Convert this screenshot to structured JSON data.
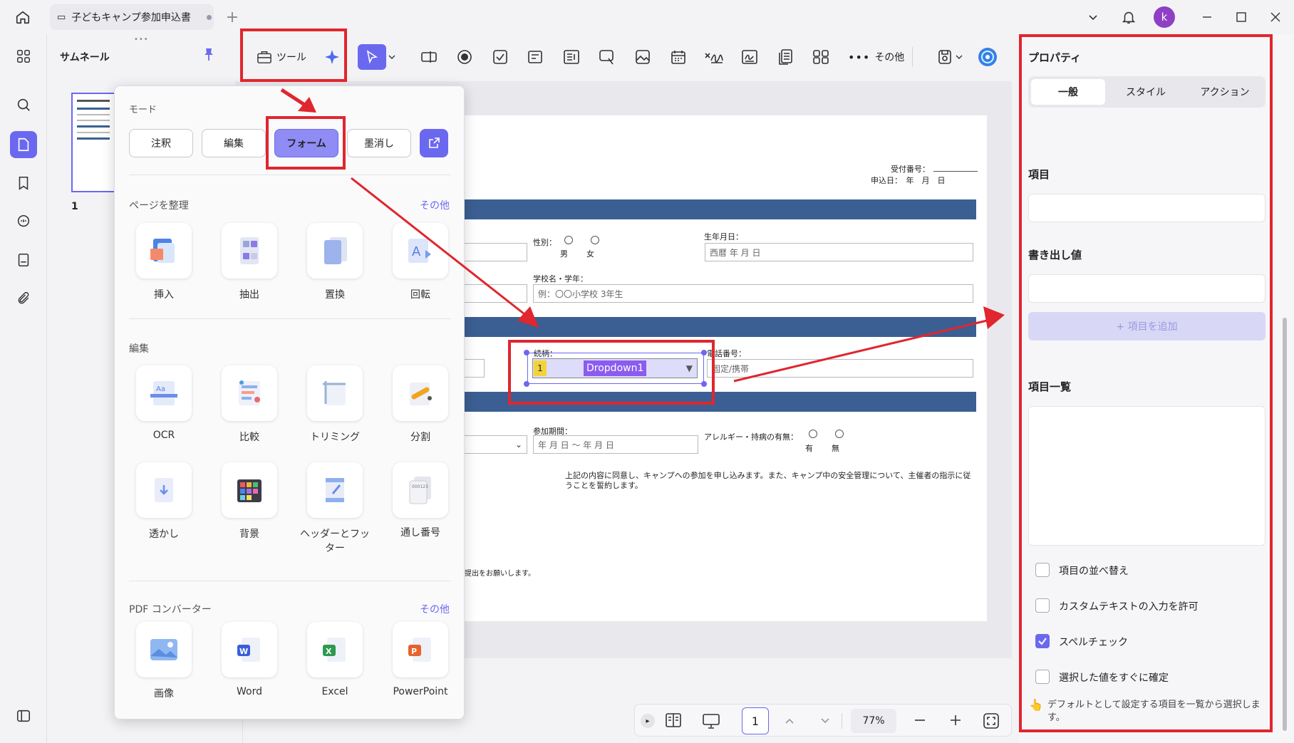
{
  "titlebar": {
    "tab_title": "子どもキャンプ参加申込書",
    "avatar_letter": "k"
  },
  "thumbnail": {
    "title": "サムネール",
    "page_number": "1"
  },
  "toolbar": {
    "tools_label": "ツール",
    "more_label": "その他"
  },
  "popup": {
    "mode_title": "モード",
    "modes": [
      "注釈",
      "編集",
      "フォーム",
      "墨消し"
    ],
    "section_organize": "ページを整理",
    "more1": "その他",
    "organize_items": [
      "挿入",
      "抽出",
      "置換",
      "回転"
    ],
    "section_edit": "編集",
    "edit_items": [
      "OCR",
      "比較",
      "トリミング",
      "分割",
      "透かし",
      "背景",
      "ヘッダーとフッター",
      "通し番号"
    ],
    "section_converter": "PDF コンバーター",
    "more2": "その他",
    "converter_items": [
      "画像",
      "Word",
      "Excel",
      "PowerPoint"
    ]
  },
  "document": {
    "receipt_label": "受付番号：",
    "apply_date": "申込日：　年　月　日",
    "gender_label": "性別：",
    "male": "男",
    "female": "女",
    "birthday_label": "生年月日：",
    "birthday_placeholder": "西暦 年 月 日",
    "school_label": "学校名・学年：",
    "school_placeholder": "例：〇〇小学校 3年生",
    "relation_label": "続柄：",
    "dropdown_value": "Dropdown1",
    "dropdown_index": "1",
    "phone_label": "電話番号：",
    "phone_placeholder": "固定/携帯",
    "period_label": "参加期間：",
    "period_placeholder": "年 月 日 ～ 年 月 日",
    "allergy_label": "アレルギー・持病の有無：",
    "yes": "有",
    "no": "無",
    "consent_text": "上記の内容に同意し、キャンプへの参加を申し込みます。また、キャンプ中の安全管理について、主催者の指示に従うことを誓約します。",
    "submit_note": "提出をお願いします。"
  },
  "properties": {
    "title": "プロパティ",
    "tabs": [
      "一般",
      "スタイル",
      "アクション"
    ],
    "item_label": "項目",
    "export_value_label": "書き出し値",
    "add_item_button": "+ 項目を追加",
    "item_list_label": "項目一覧",
    "checkboxes": [
      {
        "label": "項目の並べ替え",
        "checked": false
      },
      {
        "label": "カスタムテキストの入力を許可",
        "checked": false
      },
      {
        "label": "スペルチェック",
        "checked": true
      },
      {
        "label": "選択した値をすぐに確定",
        "checked": false
      }
    ],
    "hint": "デフォルトとして設定する項目を一覧から選択します。"
  },
  "bottom": {
    "page_input": "1",
    "zoom": "77%"
  },
  "colors": {
    "accent": "#6b68f0",
    "annotation_red": "#e0262e",
    "doc_bar": "#3b5f92",
    "dropdown_fill": "#8a5cf0"
  }
}
